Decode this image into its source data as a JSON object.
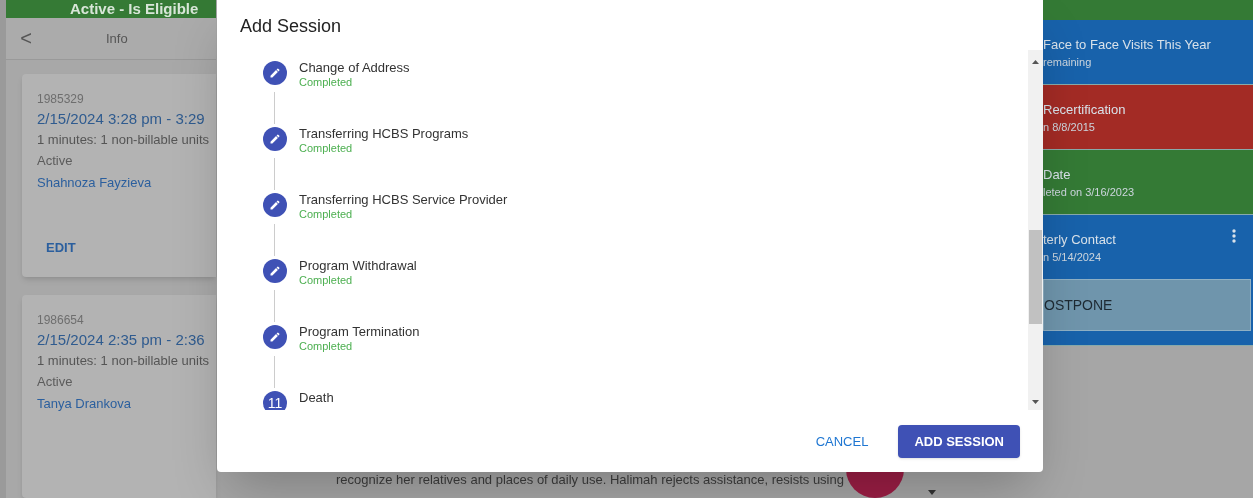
{
  "banner": {
    "text": "Active - Is Eligible"
  },
  "left_panel": {
    "back": "<",
    "title": "Info",
    "cards": [
      {
        "id": "1985329",
        "time": "2/15/2024 3:28 pm - 3:29",
        "units": "1 minutes: 1 non-billable units",
        "status": "Active",
        "person": "Shahnoza Fayzieva",
        "action": "EDIT"
      },
      {
        "id": "1986654",
        "time": "2/15/2024 2:35 pm - 2:36",
        "units": "1 minutes: 1 non-billable units",
        "status": "Active",
        "person": "Tanya Drankova"
      }
    ]
  },
  "note_lines": [
    "recognize her relatives and places of daily use. Halimah rejects assistance, resists using"
  ],
  "right_panel": [
    {
      "title": "Face to Face Visits This Year",
      "subtitle": "remaining",
      "color": "#1862ab"
    },
    {
      "title": "Recertification",
      "subtitle": "n 8/8/2015",
      "color": "#a32b25"
    },
    {
      "title": "Date",
      "subtitle": "leted on 3/16/2023",
      "color": "#347a35"
    },
    {
      "title": "terly Contact",
      "subtitle": "n 5/14/2024",
      "color": "#1862ab",
      "menu": true,
      "button": "OSTPONE"
    }
  ],
  "dialog": {
    "title": "Add Session",
    "steps": [
      {
        "kind": "edit",
        "title": "Change of Address",
        "status": "Completed"
      },
      {
        "kind": "edit",
        "title": "Transferring HCBS Programs",
        "status": "Completed"
      },
      {
        "kind": "edit",
        "title": "Transferring HCBS Service Provider",
        "status": "Completed"
      },
      {
        "kind": "edit",
        "title": "Program Withdrawal",
        "status": "Completed"
      },
      {
        "kind": "edit",
        "title": "Program Termination",
        "status": "Completed"
      },
      {
        "kind": "number",
        "number": "11",
        "title": "Death"
      }
    ],
    "buttons": [
      {
        "kind": "text",
        "label": "CANCEL"
      },
      {
        "kind": "primary",
        "label": "ADD SESSION"
      }
    ]
  }
}
